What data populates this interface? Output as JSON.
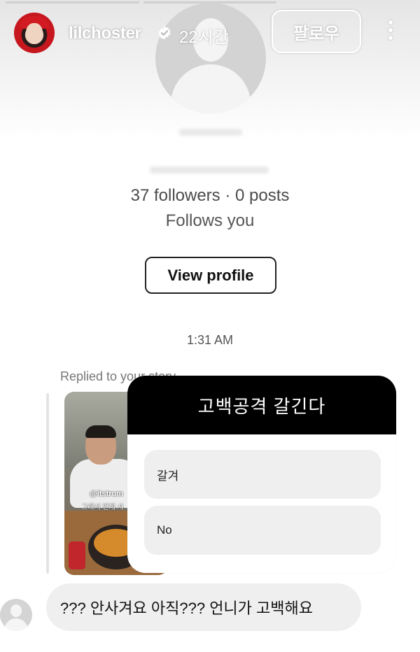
{
  "story_header": {
    "username": "lilchoster",
    "time_ago": "22시간",
    "follow_label": "팔로우",
    "verified_icon": "verified-badge-icon",
    "more_icon": "more-vertical-icon",
    "progress_segments": 3
  },
  "profile_card": {
    "stats": "37 followers · 0 posts",
    "follows_you": "Follows you",
    "view_profile_label": "View profile"
  },
  "chat": {
    "timestamp": "1:31 AM",
    "replied_label": "Replied to your story",
    "story_tag": "@itstrum",
    "story_caption": "그래서 언제 사",
    "poll": {
      "question": "고백공격 갈긴다",
      "options": [
        "갈겨",
        "No"
      ]
    },
    "message": "??? 안사겨요 아직??? 언니가 고백해요"
  },
  "colors": {
    "poll_header_bg": "#000000",
    "bubble_bg": "#efefef",
    "accent_red": "#c6171e"
  }
}
